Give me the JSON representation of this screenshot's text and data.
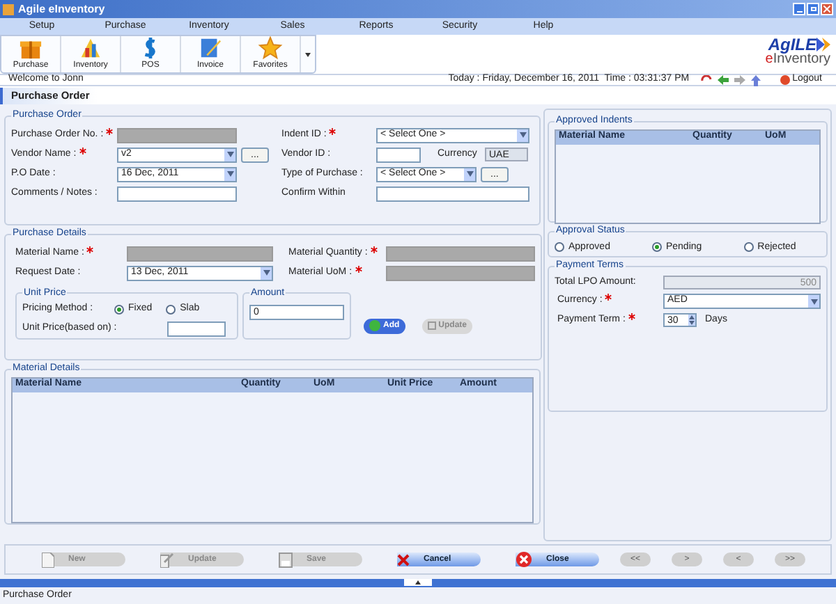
{
  "window": {
    "title": "Agile eInventory"
  },
  "menu": [
    "Setup",
    "Purchase",
    "Inventory",
    "Sales",
    "Reports",
    "Security",
    "Help"
  ],
  "toolbar": [
    {
      "label": "Purchase",
      "kind": "purchase"
    },
    {
      "label": "Inventory",
      "kind": "inventory"
    },
    {
      "label": "POS",
      "kind": "pos"
    },
    {
      "label": "Invoice",
      "kind": "invoice"
    },
    {
      "label": "Favorites",
      "kind": "favorites"
    }
  ],
  "logo": {
    "brand": "AgILE",
    "product_initial": "e",
    "product": "Inventory"
  },
  "welcome": "Welcome to Jonn",
  "datetime": "Today : Friday, December 16, 2011  Time : 03:31:37 PM",
  "logout": "Logout",
  "tab": {
    "label": "Purchase Order",
    "selected": true
  },
  "purchase_order": {
    "title": "Purchase Order",
    "fields": [
      {
        "label": "Purchase Order No. :",
        "required": true,
        "kind": "readonly"
      },
      {
        "label": "Indent ID :",
        "required": true,
        "kind": "select",
        "value": "< Select One >"
      },
      {
        "label": "Vendor Name :",
        "required": true,
        "kind": "select",
        "value": "v2",
        "browse": "..."
      },
      {
        "label": "Vendor ID :",
        "required": false,
        "kind": "text"
      },
      {
        "label": "P.O Date :",
        "required": false,
        "kind": "select",
        "value": "16 Dec, 2011"
      },
      {
        "label": "Type of Purchase :",
        "required": false,
        "kind": "select",
        "value": "< Select One >",
        "browse": "..."
      },
      {
        "label": "Comments / Notes :",
        "required": false,
        "kind": "text"
      },
      {
        "label": "Confirm Within",
        "required": false,
        "kind": "text"
      }
    ],
    "currency": {
      "label": "Currency",
      "value": "UAE"
    }
  },
  "purchase_details": {
    "title": "Purchase Details",
    "fields": [
      {
        "label": "Material Name :",
        "required": true,
        "kind": "readonly"
      },
      {
        "label": "Material Quantity :",
        "required": true,
        "kind": "readonly"
      },
      {
        "label": "Request Date :",
        "required": false,
        "kind": "select",
        "value": "13 Dec, 2011"
      },
      {
        "label": "Material UoM :",
        "required": true,
        "kind": "readonly"
      }
    ],
    "unit_price": {
      "title": "Unit Price",
      "pricing_label": "Pricing Method :",
      "options": [
        {
          "label": "Fixed",
          "selected": true
        },
        {
          "label": "Slab",
          "selected": false
        }
      ],
      "based_on_label": "Unit Price(based on) :"
    },
    "amount": {
      "title": "Amount",
      "value": "0"
    },
    "buttons": [
      {
        "label": "Add",
        "disabled": false
      },
      {
        "label": "Update",
        "disabled": true
      }
    ]
  },
  "material_details": {
    "title": "Material Details",
    "columns": [
      "Material Name",
      "Quantity",
      "UoM",
      "Unit Price",
      "Amount"
    ]
  },
  "approved_indents": {
    "title": "Approved Indents",
    "columns": [
      "Material Name",
      "Quantity",
      "UoM"
    ]
  },
  "approval_status": {
    "title": "Approval Status",
    "options": [
      {
        "label": "Approved",
        "selected": false
      },
      {
        "label": "Pending",
        "selected": true
      },
      {
        "label": "Rejected",
        "selected": false
      }
    ]
  },
  "payment_terms": {
    "title": "Payment Terms",
    "total_label": "Total LPO Amount:",
    "total_value": "500",
    "currency_label": "Currency :",
    "currency_required": true,
    "currency_value": "AED",
    "term_label": "Payment Term :",
    "term_required": true,
    "term_value": "30",
    "term_unit": "Days"
  },
  "actions": [
    {
      "label": "New",
      "kind": "new",
      "disabled": true
    },
    {
      "label": "Update",
      "kind": "update",
      "disabled": true
    },
    {
      "label": "Save",
      "kind": "save",
      "disabled": true
    },
    {
      "label": "Cancel",
      "kind": "cancel",
      "disabled": false
    },
    {
      "label": "Close",
      "kind": "close",
      "disabled": false
    },
    {
      "label": "<<",
      "kind": "nav",
      "disabled": true
    },
    {
      "label": ">",
      "kind": "nav",
      "disabled": true
    },
    {
      "label": "<",
      "kind": "nav",
      "disabled": true
    },
    {
      "label": ">>",
      "kind": "nav",
      "disabled": true
    }
  ],
  "status_bar": "Purchase Order"
}
